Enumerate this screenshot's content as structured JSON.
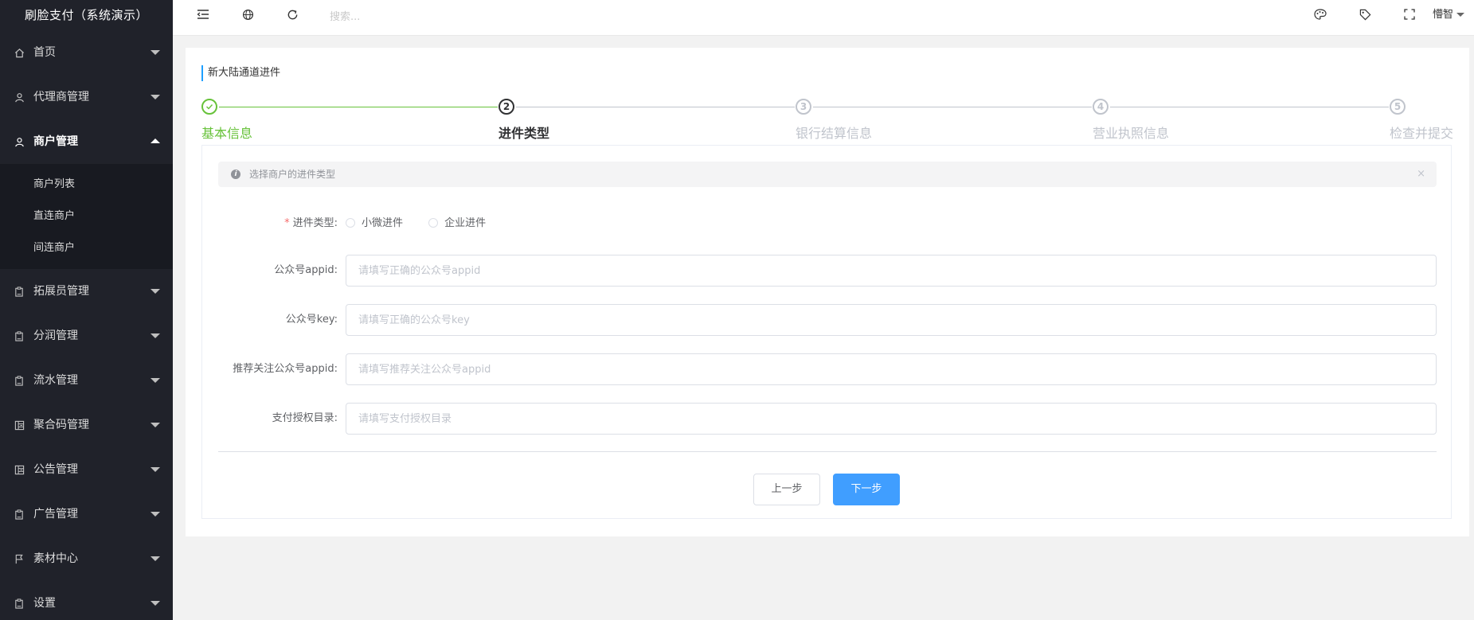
{
  "app": {
    "title": "刷脸支付（系统演示）"
  },
  "sidebar": {
    "items": [
      {
        "label": "首页",
        "icon": "home-icon"
      },
      {
        "label": "代理商管理",
        "icon": "user-icon"
      },
      {
        "label": "商户管理",
        "icon": "user-icon",
        "open": true,
        "children": [
          {
            "label": "商户列表"
          },
          {
            "label": "直连商户"
          },
          {
            "label": "间连商户"
          }
        ]
      },
      {
        "label": "拓展员管理",
        "icon": "clipboard-icon"
      },
      {
        "label": "分润管理",
        "icon": "clipboard-icon"
      },
      {
        "label": "流水管理",
        "icon": "clipboard-icon"
      },
      {
        "label": "聚合码管理",
        "icon": "grid-icon"
      },
      {
        "label": "公告管理",
        "icon": "grid-icon"
      },
      {
        "label": "广告管理",
        "icon": "clipboard-icon"
      },
      {
        "label": "素材中心",
        "icon": "flag-icon"
      },
      {
        "label": "设置",
        "icon": "clipboard-icon"
      }
    ]
  },
  "header": {
    "search_placeholder": "搜索...",
    "user_name": "懵智"
  },
  "page": {
    "title": "新大陆通道进件"
  },
  "steps": [
    {
      "number": "1",
      "title": "基本信息",
      "status": "done"
    },
    {
      "number": "2",
      "title": "进件类型",
      "status": "active"
    },
    {
      "number": "3",
      "title": "银行结算信息",
      "status": "wait"
    },
    {
      "number": "4",
      "title": "营业执照信息",
      "status": "wait"
    },
    {
      "number": "5",
      "title": "检查并提交",
      "status": "wait"
    }
  ],
  "alert": {
    "text": "选择商户的进件类型",
    "close": "×"
  },
  "form": {
    "type": {
      "label": "进件类型:",
      "required_mark": "*",
      "options": [
        "小微进件",
        "企业进件"
      ]
    },
    "appid": {
      "label": "公众号appid:",
      "placeholder": "请填写正确的公众号appid"
    },
    "key": {
      "label": "公众号key:",
      "placeholder": "请填写正确的公众号key"
    },
    "rec_appid": {
      "label": "推荐关注公众号appid:",
      "placeholder": "请填写推荐关注公众号appid"
    },
    "pay_dir": {
      "label": "支付授权目录:",
      "placeholder": "请填写支付授权目录"
    }
  },
  "buttons": {
    "prev": "上一步",
    "next": "下一步"
  },
  "colors": {
    "accent": "#409eff",
    "success": "#67c23a",
    "sidebar": "#20222a"
  }
}
